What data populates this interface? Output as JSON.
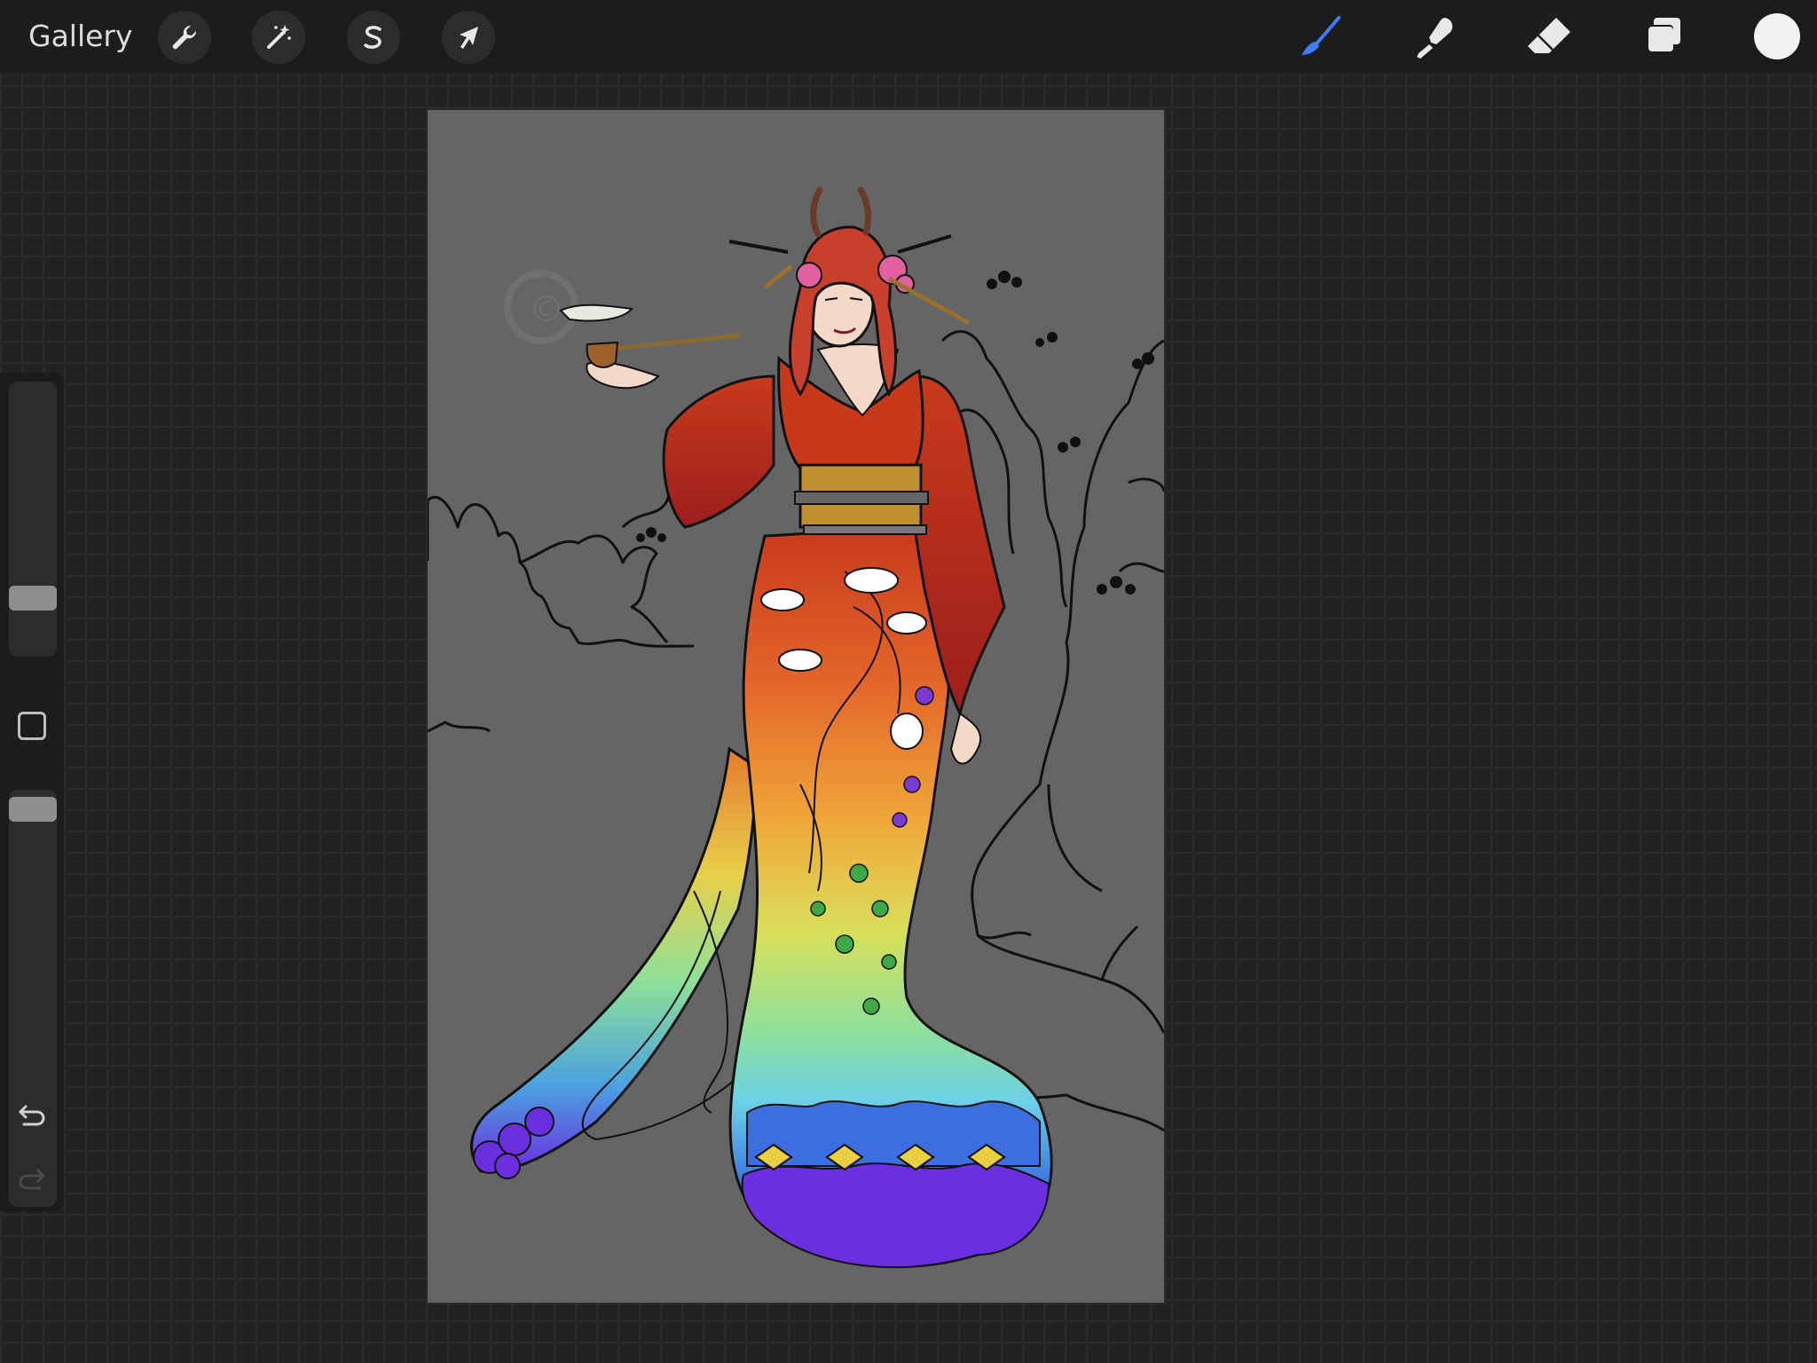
{
  "topbar": {
    "gallery_label": "Gallery",
    "left_tools": [
      {
        "name": "actions",
        "icon": "wrench-icon"
      },
      {
        "name": "adjustments",
        "icon": "magic-wand-icon"
      },
      {
        "name": "selection",
        "icon": "selection-s-icon"
      },
      {
        "name": "transform",
        "icon": "arrow-cursor-icon"
      }
    ],
    "right_tools": [
      {
        "name": "brush",
        "icon": "brush-icon",
        "active": true
      },
      {
        "name": "smudge",
        "icon": "smudge-icon",
        "active": false
      },
      {
        "name": "eraser",
        "icon": "eraser-icon",
        "active": false
      },
      {
        "name": "layers",
        "icon": "layers-icon",
        "active": false
      }
    ],
    "active_color": "#f2f2f2",
    "accent_color": "#3d7bf0"
  },
  "sidebar": {
    "brush_size_level": 0.2,
    "opacity_level": 1.0,
    "modify_icon": "square-modify-icon",
    "undo_icon": "undo-icon",
    "redo_icon": "redo-icon"
  },
  "canvas": {
    "background_color": "#656566",
    "artwork": "kimono-figure-illustration",
    "watermark": "© ..."
  }
}
